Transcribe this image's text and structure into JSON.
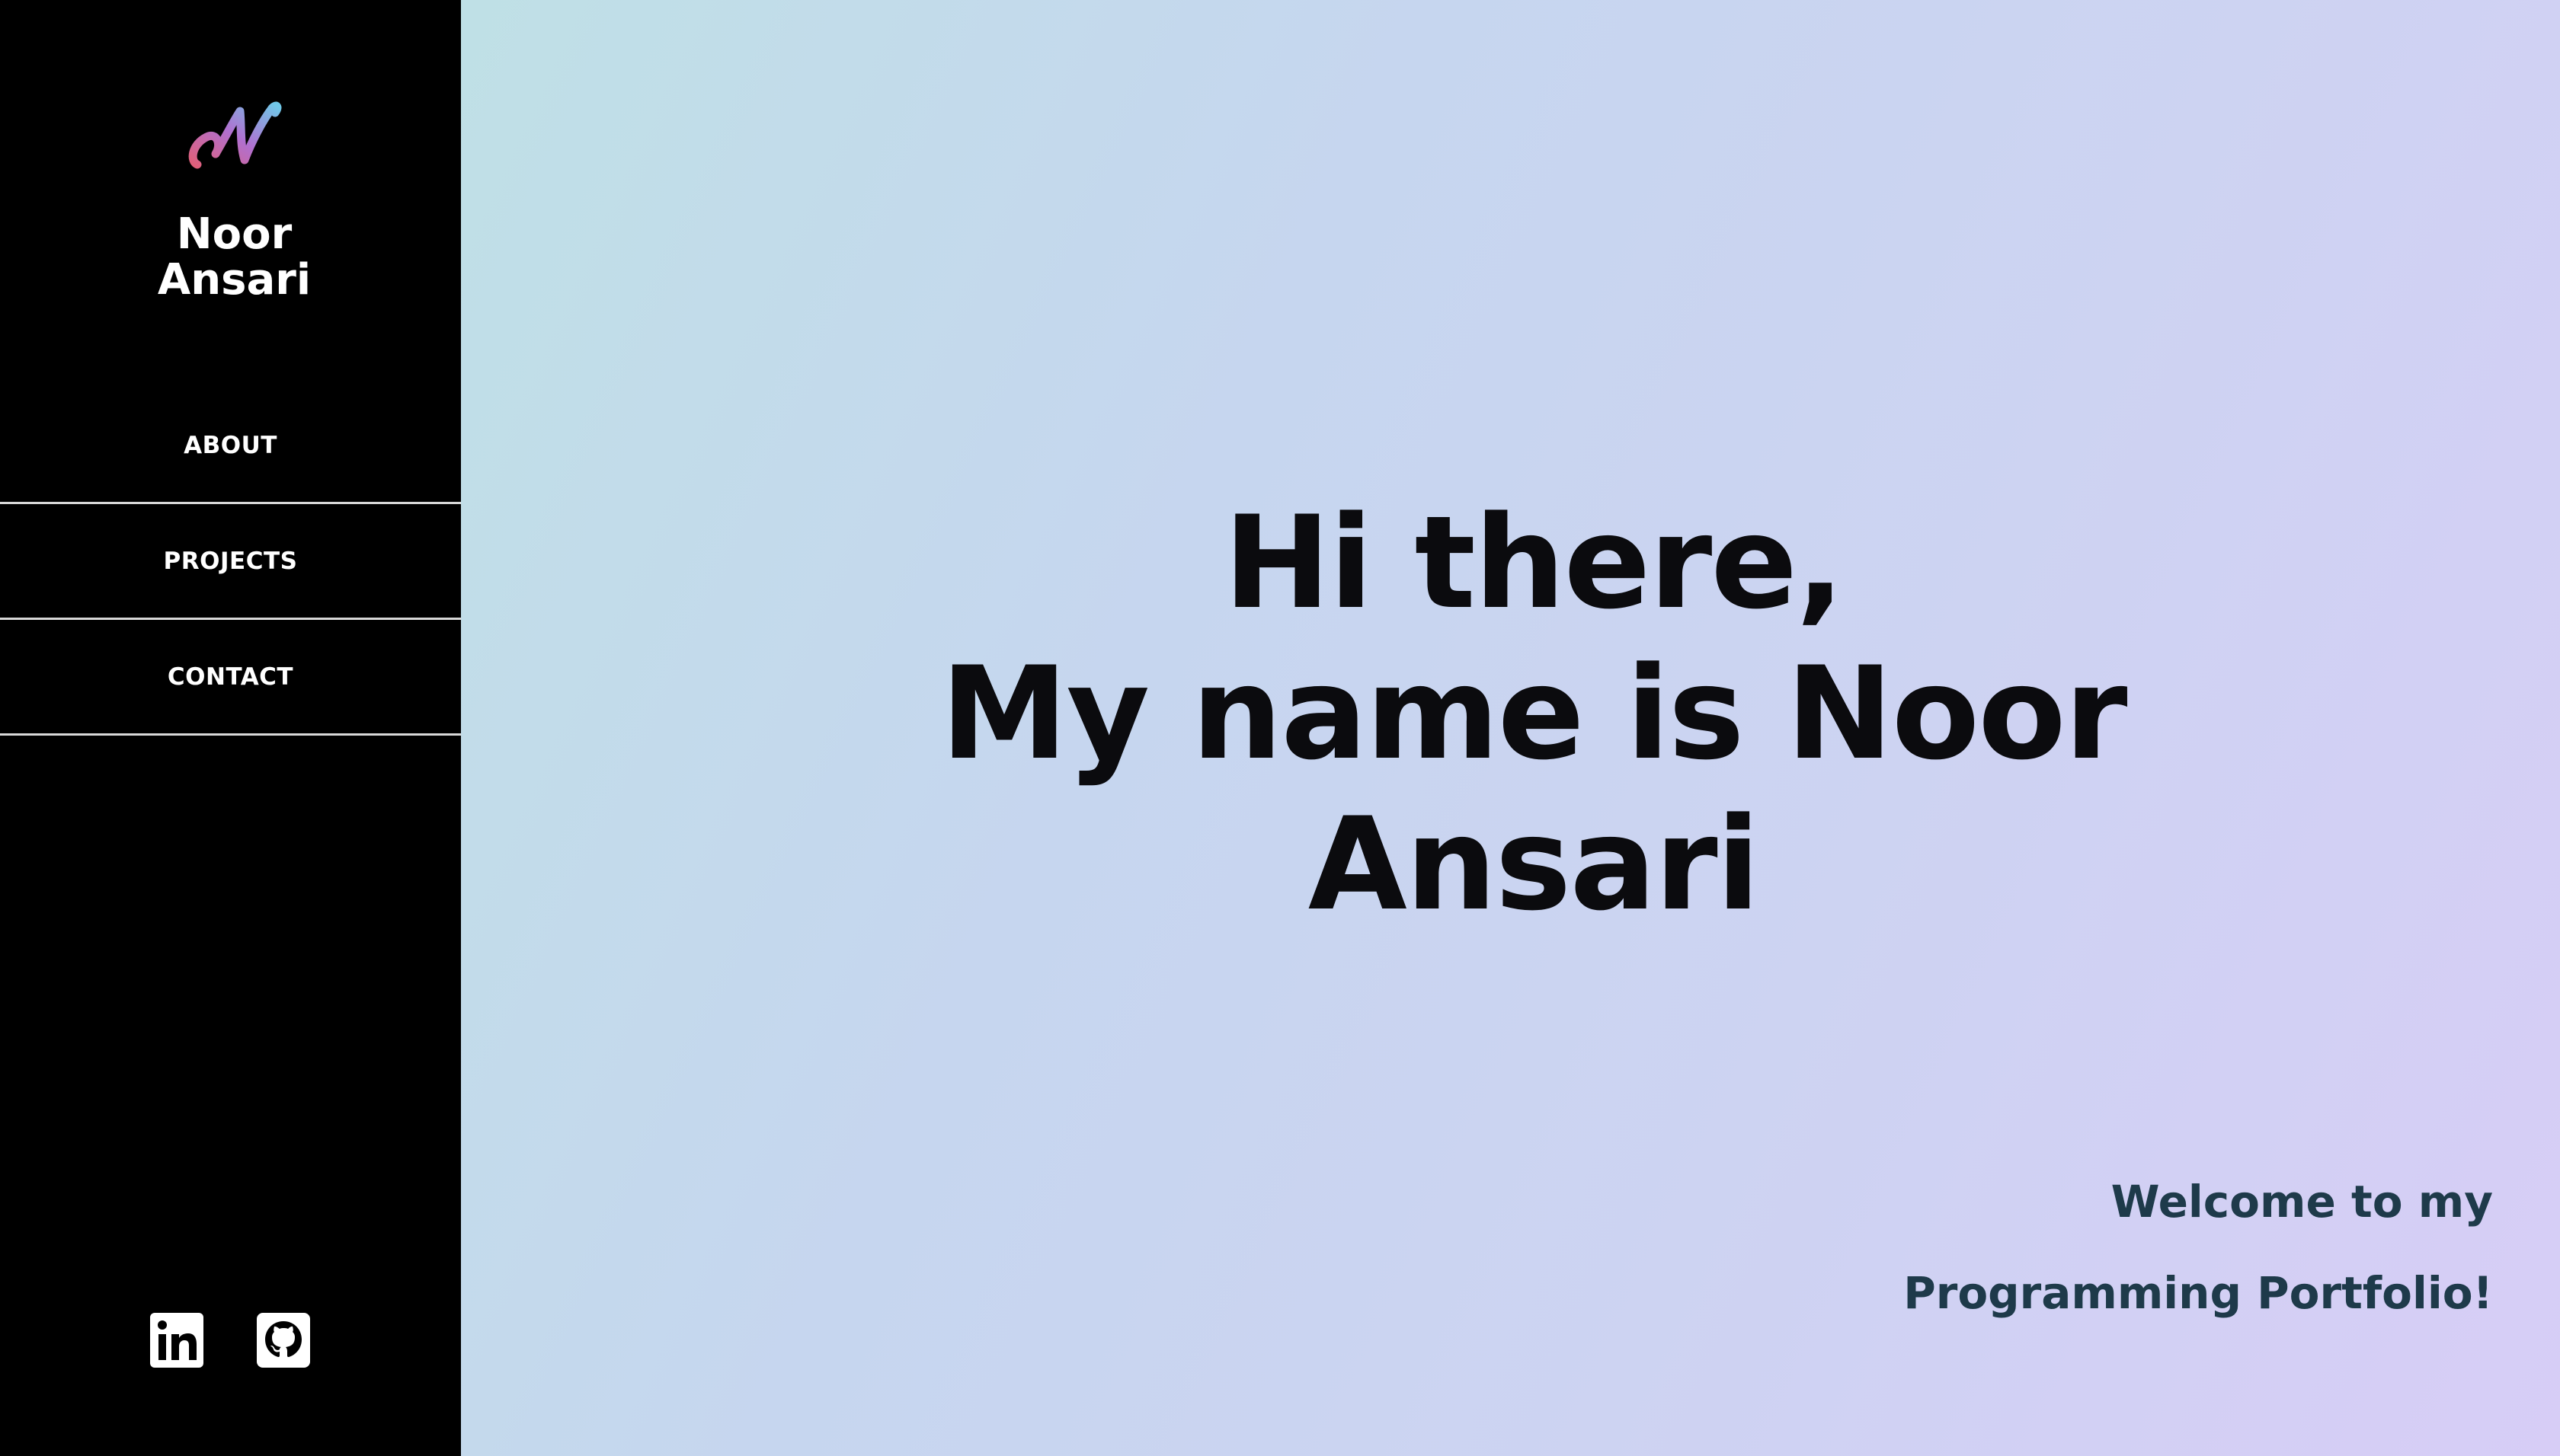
{
  "sidebar": {
    "logo_icon": "script-n-logo-icon",
    "name_line1": "Noor",
    "name_line2": "Ansari",
    "nav": [
      {
        "label": "ABOUT"
      },
      {
        "label": "PROJECTS"
      },
      {
        "label": "CONTACT"
      }
    ],
    "social": [
      {
        "icon": "linkedin-icon"
      },
      {
        "icon": "github-icon"
      }
    ]
  },
  "main": {
    "hero": {
      "line1": "Hi there,",
      "line2": "My name is Noor",
      "line3": "Ansari"
    },
    "welcome": {
      "line1": "Welcome to my",
      "line2": "Programming Portfolio!"
    }
  },
  "colors": {
    "sidebar_bg": "#000000",
    "hero_text": "#0b0b0e",
    "welcome_text": "#1e3a4a",
    "gradient_start": "#bfe0e6",
    "gradient_end": "#d7cdf6"
  }
}
